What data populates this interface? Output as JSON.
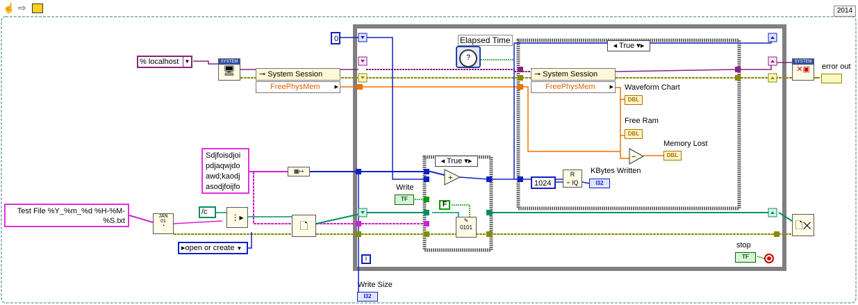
{
  "toolbar": {
    "icons": [
      "hand-icon",
      "arrow-icon",
      "run-icon"
    ]
  },
  "version_badge": "2014",
  "controls": {
    "host": "localhost",
    "host_prefix": "%",
    "zero_const": "0",
    "text_const": "Sdjfoisdjoi\npdjaqwjdo\nawd;kaodj\nasodjfoijfo",
    "filename_format": "Test File %Y_%m_%d %H-%M-\n%S.txt",
    "path_const": "/c",
    "open_mode": "open or create",
    "const_1024": "1024",
    "false_const": "F"
  },
  "nodes": {
    "system_session_1": {
      "title": "System Session",
      "property": "FreePhysMem"
    },
    "system_session_2": {
      "title": "System Session",
      "property": "FreePhysMem"
    },
    "elapsed_time": "Elapsed Time",
    "case_outer": "True",
    "case_inner": "True",
    "system_badge": "SYSTEM"
  },
  "labels": {
    "waveform_chart": "Waveform Chart",
    "free_ram": "Free Ram",
    "memory_lost": "Memory Lost",
    "kbytes_written": "KBytes Written",
    "write": "Write",
    "write_size": "Write Size",
    "stop": "stop",
    "error_out": "error out",
    "loop_index": "i"
  },
  "terminals": {
    "dbl": "DBL",
    "i32": "I32",
    "tf": "TF"
  },
  "colors": {
    "loop_frame": "#7f7f7f",
    "case_frame": "#7f7f7f",
    "wire_orange": "#f07000",
    "wire_blue": "#1020c0",
    "wire_pink": "#d020d0",
    "wire_purple": "#8a2080",
    "wire_olive": "#8a8a00",
    "wire_green": "#009060",
    "wire_bool": "#00a000",
    "outer_frame": "#3a7a80"
  }
}
